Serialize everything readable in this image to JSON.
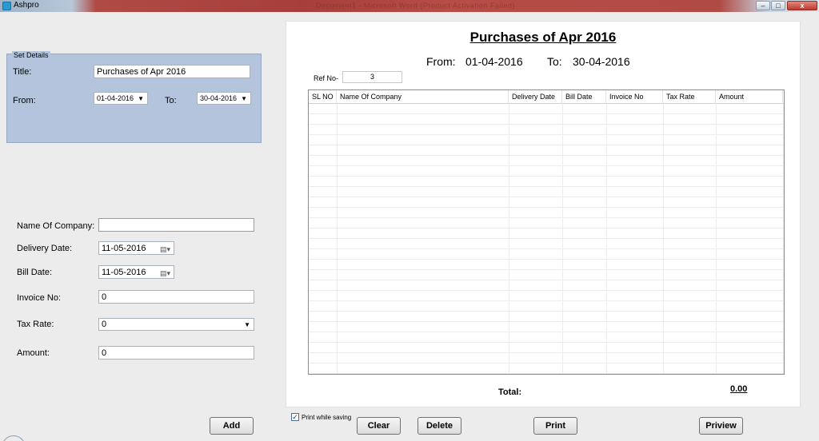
{
  "window": {
    "title": "Ashpro",
    "background_title": "Document1 - Microsoft Word (Product Activation Failed)",
    "min_symbol": "–",
    "max_symbol": "□",
    "close_symbol": "x"
  },
  "set_details": {
    "legend": "Set Details",
    "title_label": "Title:",
    "title_value": "Purchases of Apr 2016",
    "from_label": "From:",
    "from_value": "01-04-2016",
    "to_label": "To:",
    "to_value": "30-04-2016"
  },
  "form": {
    "company_label": "Name Of Company:",
    "company_value": "",
    "delivery_label": "Delivery Date:",
    "delivery_value": "11-05-2016",
    "bill_label": "Bill Date:",
    "bill_value": "11-05-2016",
    "invoice_label": "Invoice No:",
    "invoice_value": "0",
    "tax_label": "Tax Rate:",
    "tax_value": "0",
    "amount_label": "Amount:",
    "amount_value": "0",
    "add_button": "Add"
  },
  "report": {
    "title": "Purchases of Apr 2016",
    "from_label": "From:",
    "from_value": "01-04-2016",
    "to_label": "To:",
    "to_value": "30-04-2016",
    "ref_label": "Ref No-",
    "ref_value": "3",
    "columns": [
      "SL NO",
      "Name Of Company",
      "Delivery Date",
      "Bill Date",
      "Invoice No",
      "Tax Rate",
      "Amount"
    ],
    "total_label": "Total:",
    "total_value": "0.00"
  },
  "actions": {
    "print_while_saving_label": "Print while saving",
    "print_while_saving_checked": "✓",
    "clear": "Clear",
    "delete": "Delete",
    "print": "Print",
    "preview": "Priview"
  }
}
